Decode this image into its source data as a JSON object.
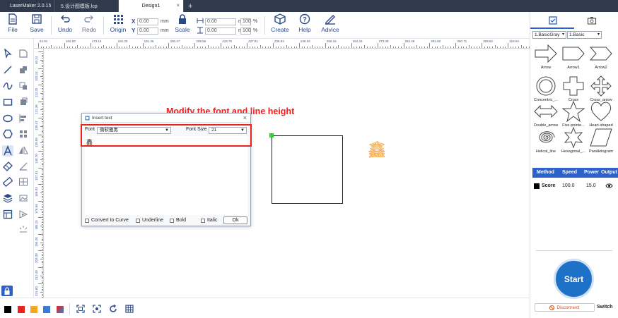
{
  "tabs": [
    {
      "label": "LaserMaker 2.0.15"
    },
    {
      "label": "5.设计图模板.lcp"
    },
    {
      "label": "Design1"
    }
  ],
  "toolbar": {
    "file": "File",
    "save": "Save",
    "undo": "Undo",
    "redo": "Redo",
    "origin": "Origin",
    "x_label": "X",
    "y_label": "Y",
    "x_value": "0.00",
    "y_value": "0.00",
    "unit_mm": "mm",
    "scale": "Scale",
    "w_value": "0.00",
    "h_value": "0.00",
    "w_pct": "100",
    "h_pct": "100",
    "pct": "%",
    "create": "Create",
    "help": "Help",
    "advice": "Advice"
  },
  "ruler": {
    "h_labels": [
      "54.91",
      "164.83",
      "173.14",
      "182.25",
      "191.36",
      "200.47",
      "209.59",
      "218.70",
      "227.81",
      "236.93",
      "246.04",
      "255.15",
      "264.26",
      "273.38",
      "282.49",
      "291.60",
      "300.71",
      "309.82",
      "318.94"
    ],
    "v_labels": [
      "40.24",
      "103.14",
      "112.25",
      "121.36",
      "130.47",
      "139.59",
      "148.70",
      "157.81",
      "166.93",
      "176.04",
      "185.15",
      "194.26",
      "203.38",
      "212.49",
      "221.60"
    ]
  },
  "annotation": "Modify the font and line height",
  "dialog": {
    "title": "Insert text",
    "font_label": "Font",
    "font_value": "微软雅黑",
    "font_size_label": "Font Size",
    "font_size_value": "21",
    "text_content": "鑫",
    "convert_to_curve": "Convert to Curve",
    "underline": "Underline",
    "bold": "Bold",
    "italic": "Italic",
    "ok": "Ok"
  },
  "canvas_glyph": "鑫",
  "right_panel": {
    "category_select": "1.BasicGray",
    "sub_select": "1.Basic",
    "shapes": [
      "Arrow",
      "Arrow1",
      "Arrow2",
      "Concentric_...",
      "Cross",
      "Cross_arrow",
      "Double_arrow",
      "Five-pointe...",
      "Heart-shaped",
      "Helical_line",
      "Hexagonal_...",
      "Parallelogram"
    ],
    "layer_headers": {
      "method": "Method",
      "speed": "Speed",
      "power": "Power",
      "output": "Output"
    },
    "layer_rows": [
      {
        "method": "Score",
        "speed": "100.0",
        "power": "15.0"
      }
    ],
    "start": "Start",
    "disconnect": "Disconnect",
    "switch": "Switch"
  },
  "colors": {
    "palette": [
      "#000000",
      "#e8231b",
      "#f5a623",
      "#3a7bd5",
      "#8a5cd0"
    ],
    "accent": "#2b61c9",
    "annotation": "#ff1a1a"
  }
}
